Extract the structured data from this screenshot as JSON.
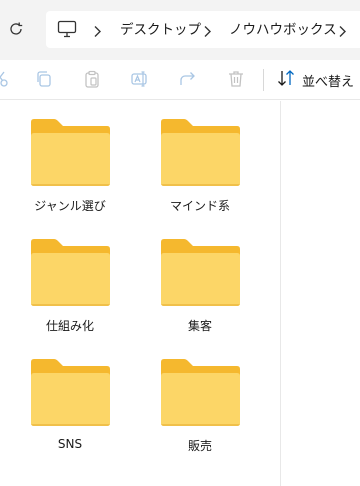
{
  "breadcrumb": {
    "items": [
      "デスクトップ",
      "ノウハウボックス"
    ]
  },
  "toolbar": {
    "sort_label": "並べ替え"
  },
  "folders": [
    {
      "name": "ジャンル選び"
    },
    {
      "name": "マインド系"
    },
    {
      "name": "仕組み化"
    },
    {
      "name": "集客"
    },
    {
      "name": "SNS"
    },
    {
      "name": "販売"
    }
  ],
  "colors": {
    "folder_back": "#f5b82e",
    "folder_front": "#fcd667",
    "accent": "#0067c0"
  }
}
